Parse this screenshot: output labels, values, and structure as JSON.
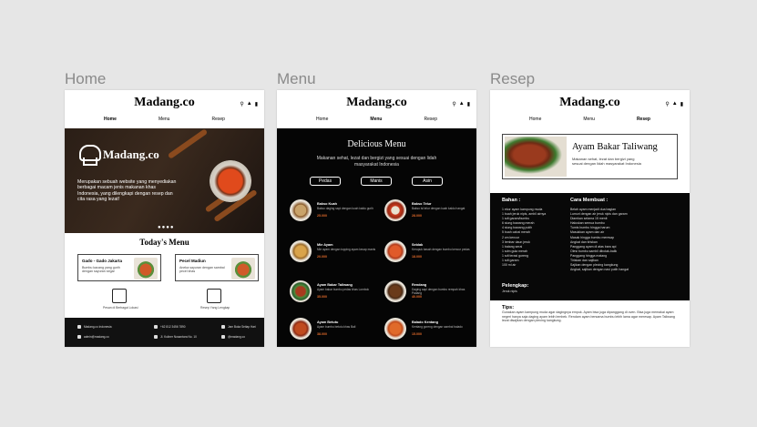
{
  "labels": {
    "home": "Home",
    "menu": "Menu",
    "resep": "Resep"
  },
  "brand": "Madang.co",
  "nav": [
    "Home",
    "Menu",
    "Resep"
  ],
  "home": {
    "hero_text": "Merupakan sebuah website yang menyediakan berbagai macam jenis makanan khas Indonesia, yang dilengkapi dengan resep dan cita rasa yang lezat!",
    "dots": "●●●●",
    "section_title": "Today's Menu",
    "cards": [
      {
        "title": "Gado - Gado Jakarta",
        "desc": "Bumbu kacang yang gurih dengan sayuran segar"
      },
      {
        "title": "Pecel Madiun",
        "desc": "Aneka sayuran dengan sambal pecel khas"
      }
    ],
    "icon_captions": [
      "Pesan di Berbagai Lokasi",
      "Resep Yang Lengkap"
    ],
    "footer": [
      "Madang.co Indonesia",
      "+62 812 3456 7890",
      "Jam Buka Setiap Hari",
      "admin@madang.co",
      "Jl. Kuliner Nusantara No. 10",
      "@madang.co"
    ]
  },
  "menu": {
    "title": "Delicious Menu",
    "subtitle": "Makanan sehat, lezat dan bergizi yang sesuai dengan lidah masyarakat Indonesia",
    "filters": [
      "Pedas",
      "Manis",
      "Asin"
    ],
    "items": [
      {
        "name": "Bakso Kuah",
        "desc": "Bakso daging sapi dengan kuah kaldu gurih",
        "price": "25.000"
      },
      {
        "name": "Bakso Telur",
        "desc": "Bakso isi telur dengan kuah kaldu hangat",
        "price": "28.000"
      },
      {
        "name": "Mie Ayam",
        "desc": "Mie ayam dengan topping ayam kecap manis",
        "price": "20.000"
      },
      {
        "name": "Seblak",
        "desc": "Kerupuk basah dengan bumbu kencur pedas",
        "price": "18.000"
      },
      {
        "name": "Ayam Bakar Taliwang",
        "desc": "Ayam bakar bumbu pedas khas Lombok",
        "price": "35.000"
      },
      {
        "name": "Rendang",
        "desc": "Daging sapi dengan bumbu rempah khas Padang",
        "price": "40.000"
      },
      {
        "name": "Ayam Betutu",
        "desc": "Ayam bumbu betutu khas Bali",
        "price": "38.000"
      },
      {
        "name": "Balado Kentang",
        "desc": "Kentang goreng dengan sambal balado",
        "price": "15.000"
      }
    ]
  },
  "resep": {
    "title": "Ayam Bakar Taliwang",
    "desc": "Makanan sehat, lezat dan bergizi yang sesuai dengan lidah masyarakat Indonesia",
    "bahan_title": "Bahan :",
    "bahan": [
      "1 ekor ayam kampung muda",
      "1 buah jeruk nipis, ambil airnya",
      "1 sdt garam/bumbu",
      "6 siung bawang merah",
      "4 siung bawang putih",
      "5 buah cabai merah",
      "2 cm kencur",
      "3 lembar daun jeruk",
      "1 batang serai",
      "1 sdm gula merah",
      "1 sdt terasi goreng",
      "1 sdt garam",
      "100 ml air"
    ],
    "cara_title": "Cara Membuat :",
    "cara": [
      "Belah ayam menjadi dua bagian",
      "Lumuri dengan air jeruk nipis dan garam",
      "Diamkan selama 15 menit",
      "Haluskan semua bumbu",
      "Tumis bumbu hingga harum",
      "Masukkan ayam dan air",
      "Masak hingga bumbu meresap",
      "Angkat dan tiriskan",
      "Panggang ayam di atas bara api",
      "Olesi bumbu sambil dibolak-balik",
      "Panggang hingga matang",
      "Tiriskan dan sajikan",
      "Sajikan dengan plecing kangkung",
      "Angkat, sajikan dengan nasi putih hangat"
    ],
    "pelengkap_title": "Pelengkap:",
    "pelengkap": "Jeruk nipis",
    "tips_title": "Tips:",
    "tips": "Gunakan ayam kampung muda agar dagingnya empuk. Ayam bisa juga dipanggang di oven. Bisa juga memakai ayam negeri hanya saja daging ayam lebih lembek. Rendam ayam bersama bumbu lebih lama agar meresap. Ayam Taliwang lezat disajikan dengan plecing kangkung."
  }
}
